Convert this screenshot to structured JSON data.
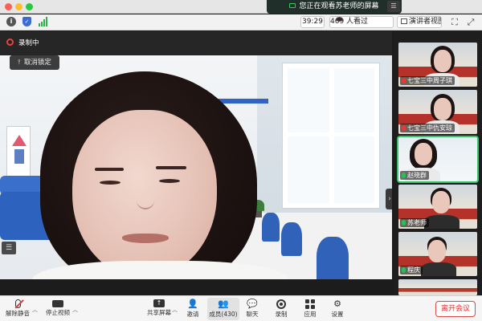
{
  "titlebar": {
    "share_banner": "您正在观看苏老师的屏幕"
  },
  "toolbar": {
    "timer": "39:29",
    "viewers": "469 人看过",
    "view_mode": "演讲者视图"
  },
  "main": {
    "recording_label": "录制中",
    "unlock_label": "取消锁定"
  },
  "sidebar": {
    "participants": [
      {
        "name": "七宝三中周子琪",
        "muted": true
      },
      {
        "name": "七宝三中仇安琼",
        "muted": true
      },
      {
        "name": "赵晓群",
        "muted": false
      },
      {
        "name": "苏老师",
        "muted": false
      },
      {
        "name": "程庆",
        "muted": false
      }
    ]
  },
  "bottombar": {
    "unmute": "解除静音",
    "stop_video": "停止视频",
    "share_screen": "共享屏幕",
    "invite": "邀请",
    "members": "成员(430)",
    "chat": "聊天",
    "record": "录制",
    "apps": "应用",
    "settings": "设置",
    "leave": "离开会议"
  },
  "colors": {
    "leave_red": "#d33333",
    "active_green": "#33c46c",
    "banner_green": "#34c759"
  }
}
